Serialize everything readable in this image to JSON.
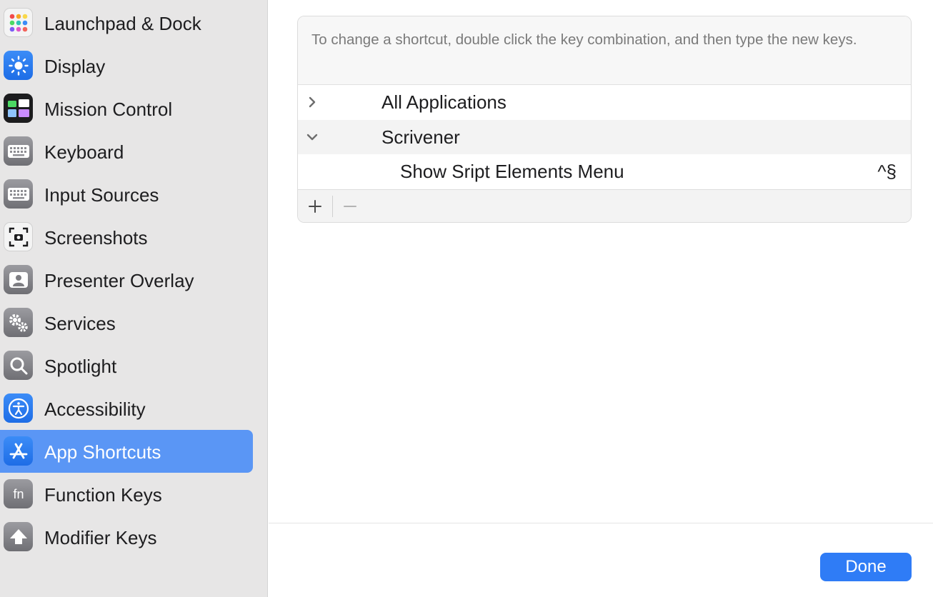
{
  "sidebar": {
    "items": [
      {
        "label": "Launchpad & Dock",
        "icon": "launchpad-icon"
      },
      {
        "label": "Display",
        "icon": "display-brightness-icon"
      },
      {
        "label": "Mission Control",
        "icon": "mission-control-icon"
      },
      {
        "label": "Keyboard",
        "icon": "keyboard-icon"
      },
      {
        "label": "Input Sources",
        "icon": "input-sources-icon"
      },
      {
        "label": "Screenshots",
        "icon": "screenshot-icon"
      },
      {
        "label": "Presenter Overlay",
        "icon": "presenter-overlay-icon"
      },
      {
        "label": "Services",
        "icon": "gears-icon"
      },
      {
        "label": "Spotlight",
        "icon": "magnifier-icon"
      },
      {
        "label": "Accessibility",
        "icon": "accessibility-icon"
      },
      {
        "label": "App Shortcuts",
        "icon": "app-store-icon",
        "selected": true
      },
      {
        "label": "Function Keys",
        "icon": "fn-icon"
      },
      {
        "label": "Modifier Keys",
        "icon": "modifier-up-arrow-icon"
      }
    ]
  },
  "panel": {
    "hint": "To change a shortcut, double click the key combination, and then type the new keys.",
    "groups": [
      {
        "label": "All Applications",
        "expanded": false
      },
      {
        "label": "Scrivener",
        "expanded": true
      }
    ],
    "shortcut": {
      "label": "Show Sript Elements Menu",
      "keys": "^§"
    },
    "add_label": "+",
    "remove_label": "−"
  },
  "footer": {
    "done_label": "Done"
  },
  "colors": {
    "accent": "#2f7cf6",
    "selected_row": "#5a96f5"
  }
}
